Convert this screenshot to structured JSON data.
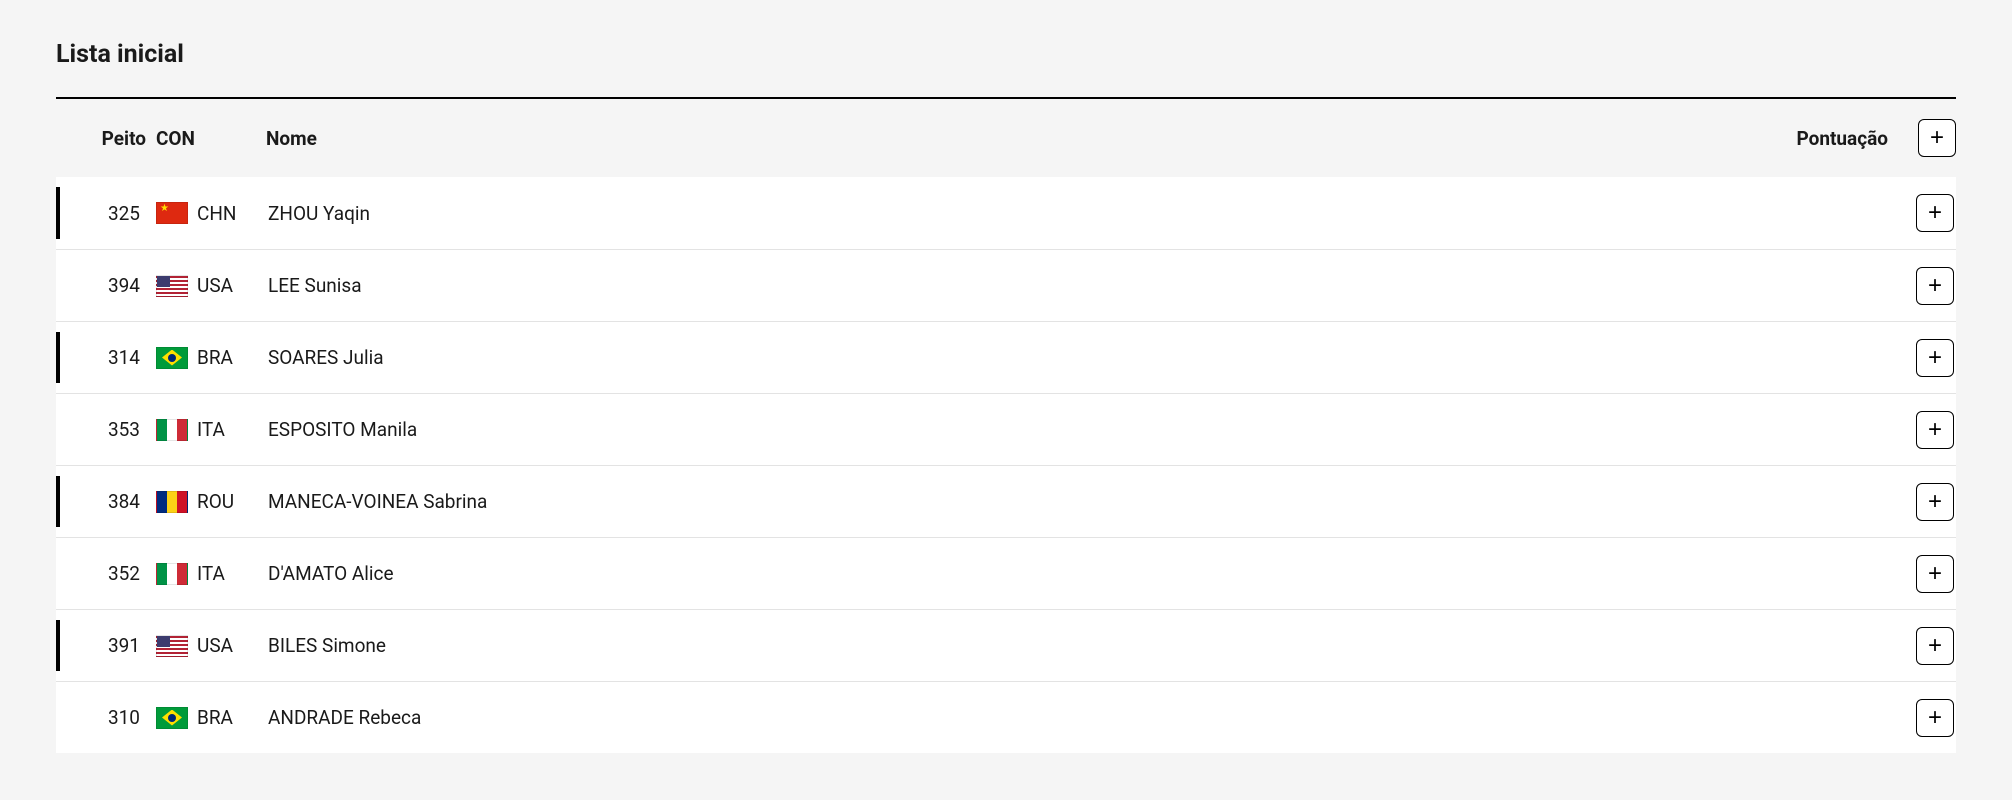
{
  "title": "Lista inicial",
  "columns": {
    "peito": "Peito",
    "con": "CON",
    "nome": "Nome",
    "pontuacao": "Pontuação"
  },
  "expand_label": "+",
  "rows": [
    {
      "peito": "325",
      "con": "CHN",
      "nome": "ZHOU Yaqin",
      "pontuacao": "",
      "border": true
    },
    {
      "peito": "394",
      "con": "USA",
      "nome": "LEE Sunisa",
      "pontuacao": "",
      "border": false
    },
    {
      "peito": "314",
      "con": "BRA",
      "nome": "SOARES Julia",
      "pontuacao": "",
      "border": true
    },
    {
      "peito": "353",
      "con": "ITA",
      "nome": "ESPOSITO Manila",
      "pontuacao": "",
      "border": false
    },
    {
      "peito": "384",
      "con": "ROU",
      "nome": "MANECA-VOINEA Sabrina",
      "pontuacao": "",
      "border": true
    },
    {
      "peito": "352",
      "con": "ITA",
      "nome": "D'AMATO Alice",
      "pontuacao": "",
      "border": false
    },
    {
      "peito": "391",
      "con": "USA",
      "nome": "BILES Simone",
      "pontuacao": "",
      "border": true
    },
    {
      "peito": "310",
      "con": "BRA",
      "nome": "ANDRADE Rebeca",
      "pontuacao": "",
      "border": false
    }
  ]
}
